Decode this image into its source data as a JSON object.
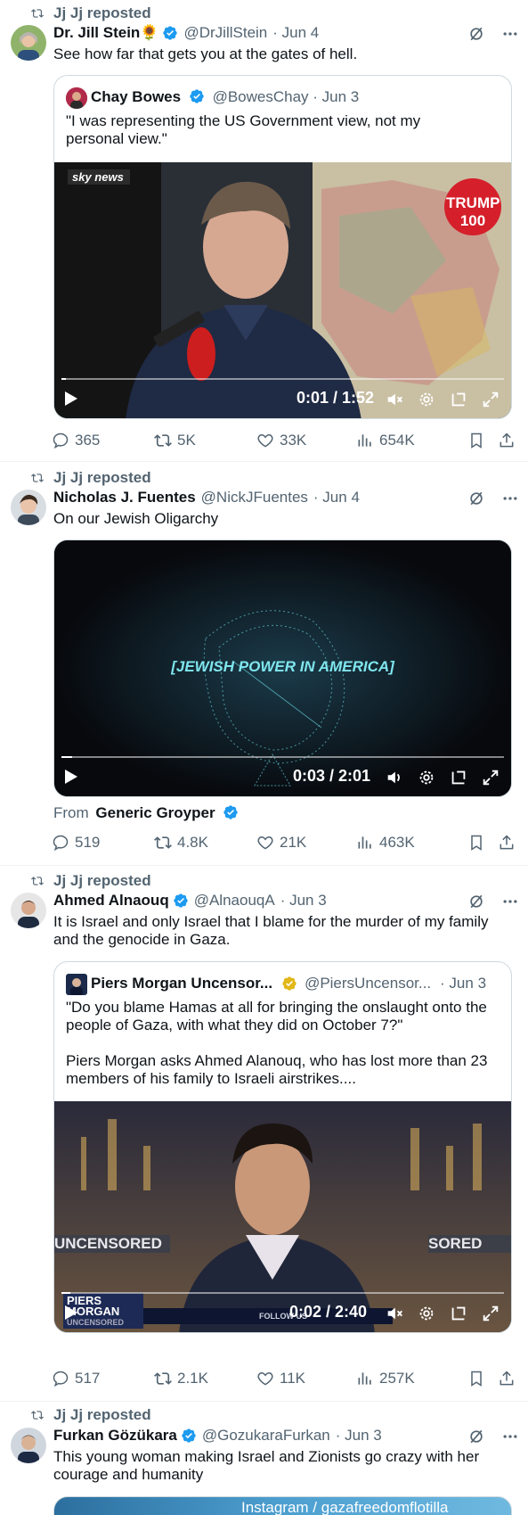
{
  "tweets": [
    {
      "reposted_by": "Jj Jj reposted",
      "author": "Dr. Jill Stein🌻",
      "handle": "@DrJillStein",
      "date": "· Jun 4",
      "text": "See how far that gets you at the gates of hell.",
      "quote": {
        "author": "Chay Bowes",
        "handle": "@BowesChay",
        "date": "· Jun 3",
        "text": "\"I was representing the US Government view, not my personal view.\"",
        "video": {
          "badge": "sky news",
          "time": "0:01 / 1:52",
          "trump_badge": "TRUMP",
          "trump_num": "100",
          "progress": 0.01
        }
      },
      "stats": {
        "replies": "365",
        "reposts": "5K",
        "likes": "33K",
        "views": "654K"
      }
    },
    {
      "reposted_by": "Jj Jj reposted",
      "author": "Nicholas J. Fuentes",
      "handle": "@NickJFuentes",
      "date": "· Jun 4",
      "text": "On our Jewish Oligarchy",
      "video": {
        "overlay_text": "[JEWISH POWER IN AMERICA]",
        "time": "0:03 / 2:01",
        "progress": 0.025
      },
      "from_label": "From",
      "from_name": "Generic Groyper",
      "stats": {
        "replies": "519",
        "reposts": "4.8K",
        "likes": "21K",
        "views": "463K"
      }
    },
    {
      "reposted_by": "Jj Jj reposted",
      "author": "Ahmed Alnaouq",
      "handle": "@AlnaouqA",
      "date": "· Jun 3",
      "text": "It is Israel and only Israel that I blame for the murder of my family and the genocide in Gaza.",
      "quote": {
        "author": "Piers Morgan Uncensor...",
        "handle": "@PiersUncensor...",
        "date": "· Jun 3",
        "text1": "\"Do you blame Hamas at all for bringing the onslaught onto the people of Gaza, with what they did on October 7?\"",
        "text2": "Piers Morgan asks Ahmed Alanouq, who has lost more than 23 members of his family to Israeli airstrikes....",
        "video": {
          "banner_left": "UNCENSORED",
          "banner_right": "SORED",
          "logo_top": "PIERS",
          "logo_mid": "MORGAN",
          "logo_bot": "UNCENSORED",
          "ticker": "FOLLOW US",
          "time": "0:02 / 2:40",
          "progress": 0.02
        }
      },
      "stats": {
        "replies": "517",
        "reposts": "2.1K",
        "likes": "11K",
        "views": "257K"
      }
    },
    {
      "reposted_by": "Jj Jj reposted",
      "author": "Furkan Gözükara",
      "handle": "@GozukaraFurkan",
      "date": "· Jun 3",
      "text": "This young woman making Israel and Zionists go crazy with her courage and humanity",
      "media_text": "Instagram / gazafreedomflotilla"
    }
  ],
  "colors": {
    "verified_blue": "#1d9bf0",
    "gold_check": "#e2b719",
    "muted": "#536471",
    "border": "#cfd9de",
    "text": "#0f1419"
  }
}
